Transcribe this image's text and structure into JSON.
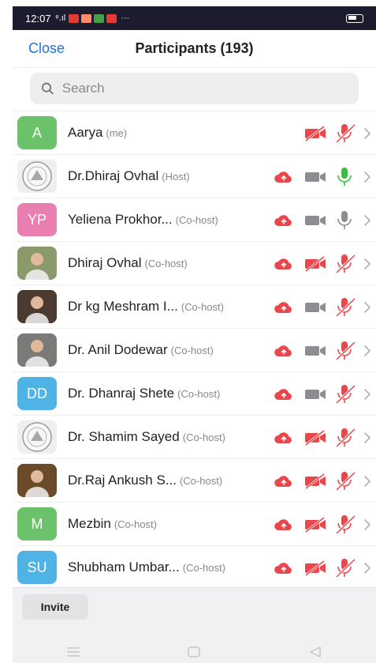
{
  "status_bar": {
    "time": "12:07",
    "signal": "ᵉ.ıl",
    "dots": "···"
  },
  "header": {
    "close_label": "Close",
    "title": "Participants (193)"
  },
  "search": {
    "placeholder": "Search"
  },
  "participants": [
    {
      "name": "Aarya",
      "role": "(me)",
      "avatar_text": "A",
      "avatar_color": "#6cc16b",
      "avatar_type": "initials",
      "cloud": false,
      "video": "off",
      "mic": "muted"
    },
    {
      "name": "Dr.Dhiraj Ovhal",
      "role": "(Host)",
      "avatar_text": "",
      "avatar_color": "#d9d9d9",
      "avatar_type": "seal",
      "cloud": true,
      "video": "on",
      "mic": "active"
    },
    {
      "name": "Yeliena Prokhor...",
      "role": "(Co-host)",
      "avatar_text": "YP",
      "avatar_color": "#e97fb1",
      "avatar_type": "initials",
      "cloud": true,
      "video": "on",
      "mic": "idle"
    },
    {
      "name": "Dhiraj Ovhal",
      "role": "(Co-host)",
      "avatar_text": "",
      "avatar_color": "#8a9a6a",
      "avatar_type": "photo",
      "cloud": true,
      "video": "off",
      "mic": "muted"
    },
    {
      "name": "Dr kg Meshram I...",
      "role": "(Co-host)",
      "avatar_text": "",
      "avatar_color": "#4a3a30",
      "avatar_type": "photo",
      "cloud": true,
      "video": "on",
      "mic": "muted"
    },
    {
      "name": "Dr. Anil Dodewar",
      "role": "(Co-host)",
      "avatar_text": "",
      "avatar_color": "#7a7a78",
      "avatar_type": "photo",
      "cloud": true,
      "video": "on",
      "mic": "muted"
    },
    {
      "name": "Dr. Dhanraj Shete",
      "role": "(Co-host)",
      "avatar_text": "DD",
      "avatar_color": "#4fb3e6",
      "avatar_type": "initials",
      "cloud": true,
      "video": "on",
      "mic": "muted"
    },
    {
      "name": "Dr. Shamim Sayed",
      "role": "(Co-host)",
      "avatar_text": "",
      "avatar_color": "#d9d9d9",
      "avatar_type": "seal",
      "cloud": true,
      "video": "off",
      "mic": "muted"
    },
    {
      "name": "Dr.Raj Ankush S...",
      "role": "(Co-host)",
      "avatar_text": "",
      "avatar_color": "#6b4a2a",
      "avatar_type": "photo",
      "cloud": true,
      "video": "off",
      "mic": "muted"
    },
    {
      "name": "Mezbin",
      "role": "(Co-host)",
      "avatar_text": "M",
      "avatar_color": "#6cc16b",
      "avatar_type": "initials",
      "cloud": true,
      "video": "off",
      "mic": "muted"
    },
    {
      "name": "Shubham Umbar...",
      "role": "(Co-host)",
      "avatar_text": "SU",
      "avatar_color": "#4fb3e6",
      "avatar_type": "initials",
      "cloud": true,
      "video": "off",
      "mic": "muted"
    }
  ],
  "footer": {
    "invite_label": "Invite"
  },
  "colors": {
    "accent": "#1e73d6",
    "muted_red": "#e8474c",
    "mic_green": "#3bbf3b",
    "icon_gray": "#8e8e92"
  }
}
